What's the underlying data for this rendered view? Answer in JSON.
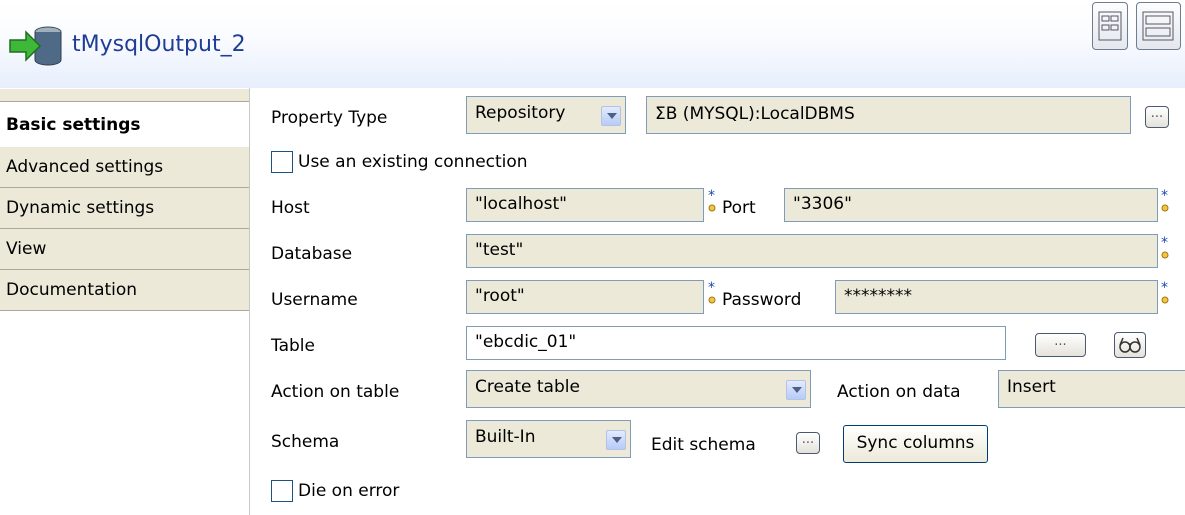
{
  "header": {
    "component_icon": "db-output-arrow-icon",
    "title": "tMysqlOutput_2",
    "view_buttons": [
      "layout-two-columns-icon",
      "layout-one-column-icon"
    ]
  },
  "tabs": [
    {
      "label": "Basic settings",
      "active": true
    },
    {
      "label": "Advanced settings"
    },
    {
      "label": "Dynamic settings"
    },
    {
      "label": "View"
    },
    {
      "label": "Documentation"
    }
  ],
  "form": {
    "property_type": {
      "label": "Property Type",
      "value": "Repository",
      "repository_value": "ⵉB (MYSQL):LocalDBMS",
      "browse": "..."
    },
    "use_existing_connection": {
      "label": "Use an existing connection",
      "checked": false
    },
    "host": {
      "label": "Host",
      "value": "\"localhost\""
    },
    "port": {
      "label": "Port",
      "value": "\"3306\""
    },
    "database": {
      "label": "Database",
      "value": "\"test\""
    },
    "username": {
      "label": "Username",
      "value": "\"root\""
    },
    "password": {
      "label": "Password",
      "value": "********"
    },
    "table": {
      "label": "Table",
      "value": "\"ebcdic_01\"",
      "browse": "...",
      "guess_icon": "glasses-icon"
    },
    "action_on_table": {
      "label": "Action on table",
      "value": "Create table"
    },
    "action_on_data": {
      "label": "Action on data",
      "value": "Insert"
    },
    "schema": {
      "label": "Schema",
      "value": "Built-In",
      "edit_label": "Edit schema",
      "edit_button": "...",
      "sync_button": "Sync columns"
    },
    "die_on_error": {
      "label": "Die on error",
      "checked": false
    }
  },
  "colors": {
    "title": "#1e3e96",
    "field_bg": "#ece9d8",
    "field_border": "#7f9db9"
  }
}
